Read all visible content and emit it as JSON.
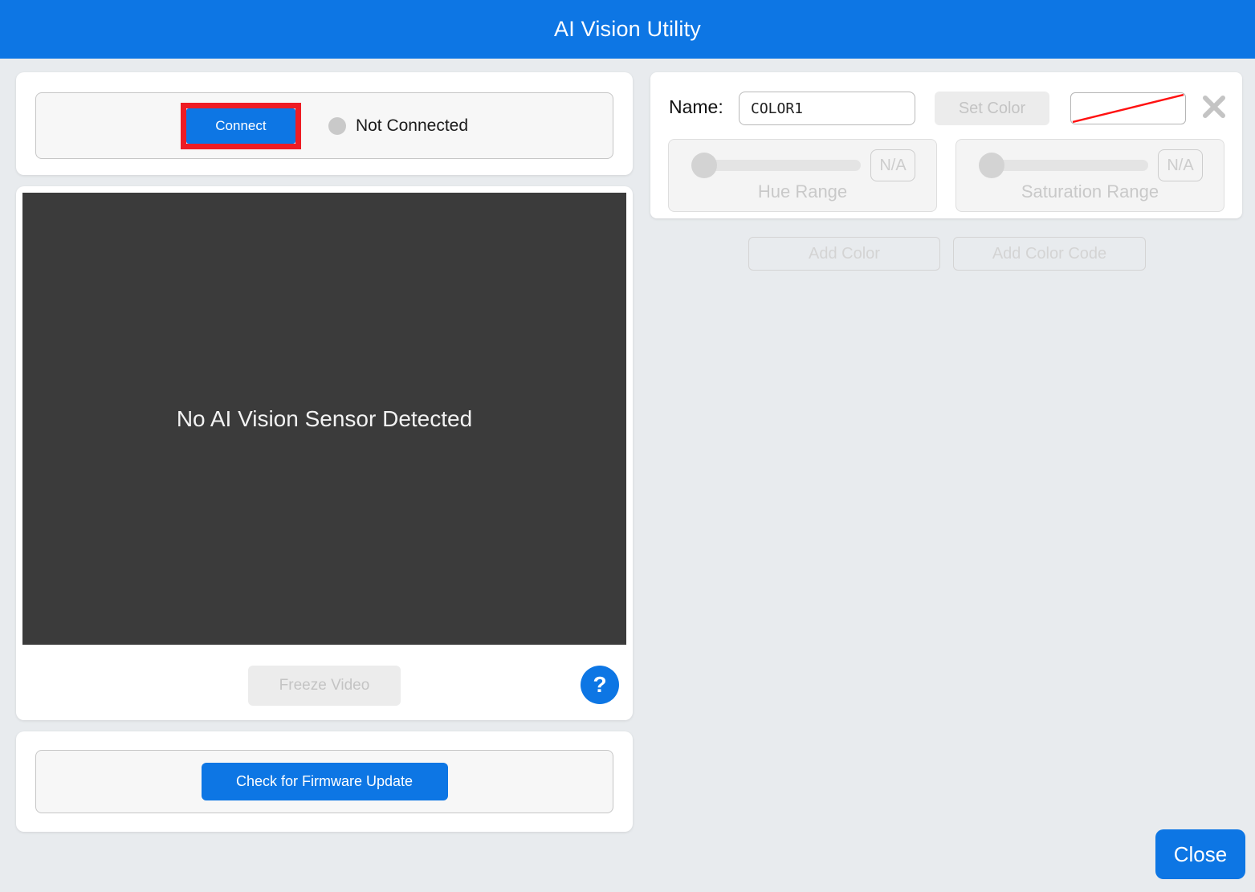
{
  "header": {
    "title": "AI Vision Utility"
  },
  "colors": {
    "accent_blue": "#0d76e4",
    "annotation_red": "#ee1c24",
    "video_background": "#3b3b3b",
    "page_background": "#e8ebee",
    "disabled_gray": "#c4c4c4",
    "swatch_line_red": "#ff1111"
  },
  "connection": {
    "connect_label": "Connect",
    "status_label": "Not Connected"
  },
  "video": {
    "placeholder": "No AI Vision Sensor Detected",
    "freeze_label": "Freeze Video",
    "help_label": "?"
  },
  "firmware": {
    "button_label": "Check for Firmware Update"
  },
  "color_editor": {
    "name_label": "Name:",
    "name_value": "COLOR1",
    "set_color_label": "Set Color",
    "hue": {
      "value_label": "N/A",
      "label": "Hue Range"
    },
    "saturation": {
      "value_label": "N/A",
      "label": "Saturation Range"
    }
  },
  "actions": {
    "add_color_label": "Add Color",
    "add_color_code_label": "Add Color Code"
  },
  "footer": {
    "close_label": "Close"
  }
}
